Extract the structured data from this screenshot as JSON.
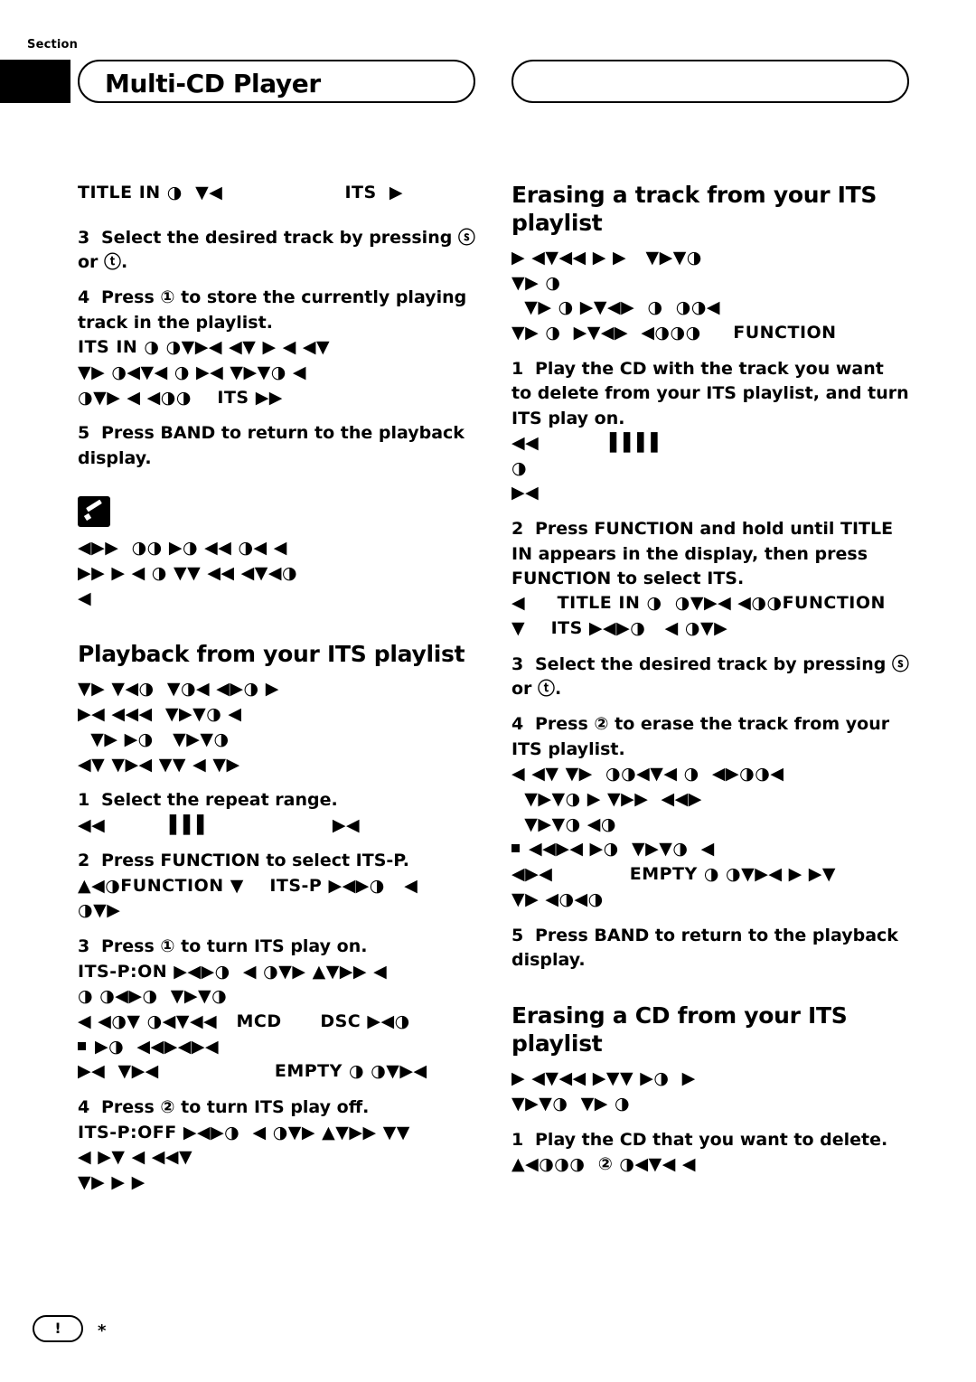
{
  "header": {
    "section_label": "Section",
    "title": "Multi-CD Player"
  },
  "left_column": {
    "glyph_row_1": "TITLE IN ◑  ▼◀                   ITS  ▶",
    "step3": {
      "num": "3",
      "text": "Select the desired track by pressing ⓢ or ⓣ."
    },
    "step4": {
      "num": "4",
      "text": "Press ① to store the currently playing track in the playlist."
    },
    "step4_glyphs_1": "ITS IN ◑ ◑▼▶◀ ◀▼ ▶ ◀ ◀▼",
    "step4_glyphs_2": "▼▶ ◑◀▼◀ ◑ ▶◀ ▼▶▼◑ ◀",
    "step4_glyphs_3": "◑▼▶ ◀ ◀◑◑    ITS ▶▶",
    "step5": {
      "num": "5",
      "text": "Press BAND to return to the playback display."
    },
    "note_glyphs_1": "◀▶▶  ◑◑ ▶◑ ◀◀ ◑◀ ◀",
    "note_glyphs_2": "▶▶ ▶ ◀ ◑ ▼▼ ◀◀ ◀▼◀◑",
    "note_glyphs_3": "◀",
    "heading_playback": "Playback from your ITS playlist",
    "playback_glyphs_1": "▼▶ ▼◀◑  ▼◑◀ ◀▶◑ ▶",
    "playback_glyphs_2": "▶◀ ◀◀◀  ▼▶▼◑ ◀",
    "playback_glyphs_3": "  ▼▶ ▶◑   ▼▶▼◑",
    "playback_glyphs_4": "◀▼ ▼▶◀ ▼▼ ◀ ▼▶",
    "pb_step1": {
      "num": "1",
      "text": "Select the repeat range."
    },
    "pb_step1_glyphs": "◀◀         ▐▐▐                    ▶◀",
    "pb_step2": {
      "num": "2",
      "text": "Press FUNCTION to select ITS-P."
    },
    "pb_step2_glyphs_1": "▲◀◑FUNCTION ▼    ITS-P ▶◀▶◑   ◀",
    "pb_step2_glyphs_2": "◑▼▶",
    "pb_step3": {
      "num": "3",
      "text": "Press ① to turn ITS play on."
    },
    "pb_step3_glyphs_1": "ITS-P:ON ▶◀▶◑  ◀ ◑▼▶ ▲▼▶▶ ◀",
    "pb_step3_glyphs_2": "◑ ◑◀▶◑  ▼▶▼◑",
    "pb_step3_glyphs_3": "◀ ◀◑▼ ◑◀▼◀◀   MCD      DSC ▶◀◑",
    "pb_step3_glyphs_4": "▶◑  ◀◀▶◀▶◀",
    "pb_step3_glyphs_5": "▶◀  ▼▶◀                  EMPTY ◑ ◑▼▶◀",
    "pb_step4": {
      "num": "4",
      "text": "Press ② to turn ITS play off."
    },
    "pb_step4_glyphs_1": "ITS-P:OFF ▶◀▶◑  ◀ ◑▼▶ ▲▼▶▶ ▼▼",
    "pb_step4_glyphs_2": "◀ ▶▼ ◀ ◀◀▼",
    "pb_step4_glyphs_3": "▼▶ ▶ ▶"
  },
  "right_column": {
    "heading_erase_track": "Erasing a track from your ITS playlist",
    "erase_glyphs_1": "▶ ◀▼◀◀ ▶ ▶   ▼▶▼◑",
    "erase_glyphs_2": "▼▶ ◑",
    "erase_glyphs_3": "  ▼▶ ◑ ▶▼◀▶  ◑  ◑◑◀",
    "erase_glyphs_4": "▼▶ ◑  ▶▼◀▶  ◀◑◑◑     FUNCTION",
    "et_step1": {
      "num": "1",
      "text": "Play the CD with the track you want to delete from your ITS playlist, and turn ITS play on."
    },
    "et_step1_glyphs_1": "◀◀          ▐▐▐▐                                        ◑",
    "et_step1_glyphs_2": "▶◀",
    "et_step2": {
      "num": "2",
      "text": "Press FUNCTION and hold until TITLE IN appears in the display, then press FUNCTION to select ITS."
    },
    "et_step2_glyphs_1": "◀     TITLE IN ◑  ◑▼▶◀ ◀◑◑FUNCTION",
    "et_step2_glyphs_2": "▼    ITS ▶◀▶◑   ◀ ◑▼▶",
    "et_step3": {
      "num": "3",
      "text": "Select the desired track by pressing ⓢ or ⓣ."
    },
    "et_step4": {
      "num": "4",
      "text": "Press ② to erase the track from your ITS playlist."
    },
    "et_step4_glyphs_1": "◀ ◀▼ ▼▶  ◑◑◀▼◀ ◑  ◀▶◑◑◀",
    "et_step4_glyphs_2": "  ▼▶▼◑ ▶ ▼▶▶  ◀◀▶",
    "et_step4_glyphs_3": "  ▼▶▼◑ ◀◑",
    "et_step4_glyphs_4": "◀◀▶◀ ▶◑  ▼▶▼◑  ◀",
    "et_step4_glyphs_5": "◀▶◀            EMPTY ◑ ◑▼▶◀ ▶ ▶▼",
    "et_step4_glyphs_6": "▼▶ ◀◑◀◑",
    "et_step5": {
      "num": "5",
      "text": "Press BAND to return to the playback display."
    },
    "heading_erase_cd": "Erasing a CD from your ITS playlist",
    "ec_glyphs_1": "▶ ◀▼◀◀ ▶▼▼ ▶◑  ▶",
    "ec_glyphs_2": "▼▶▼◑  ▼▶ ◑",
    "ec_step1": {
      "num": "1",
      "text": "Play the CD that you want to delete."
    },
    "ec_step1_glyphs": "▲◀◑◑◑  ② ◑◀▼◀ ◀"
  },
  "footer": {
    "page_number": "!",
    "star": "*"
  }
}
